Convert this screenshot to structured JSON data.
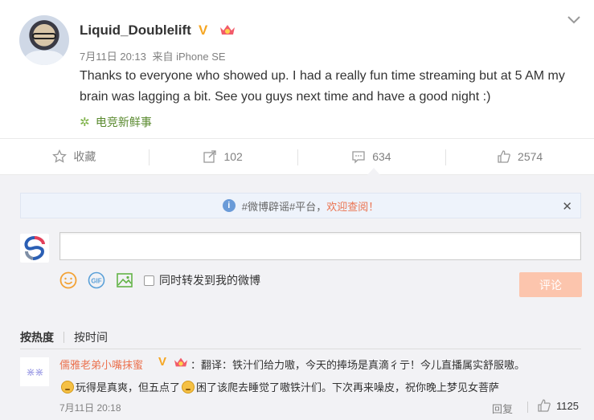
{
  "post": {
    "username": "Liquid_Doublelift",
    "verified_badge": "V",
    "date": "7月11日 20:13",
    "source": "来自 iPhone SE",
    "text": "Thanks to everyone who showed up. I had a really fun time streaming but at 5 AM my brain was lagging a bit. See you guys next time and have a good night :)",
    "topic": "电竞新鲜事"
  },
  "actions": {
    "favorite": "收藏",
    "forward_count": "102",
    "comment_count": "634",
    "like_count": "2574"
  },
  "notice": {
    "prefix": "#微博辟谣#平台，",
    "link": "欢迎查阅！"
  },
  "composer": {
    "input_value": "",
    "forward_label": "同时转发到我的微博",
    "submit_label": "评论"
  },
  "sort": {
    "hot": "按热度",
    "time": "按时间"
  },
  "comment": {
    "avatar_text": "⋇⋇",
    "name": "儒雅老弟小嘴抹蜜",
    "verified_badge": "V",
    "text1": "：翻译：铁汁们给力嗷，今天的捧场是真滴彳亍！今儿直播属实舒服嗷。",
    "text2a": "玩得是真爽，但五点了",
    "text2b": "困了该爬去睡觉了嗷铁汁们。下次再来噪皮，祝你晚上梦见女菩萨",
    "time": "7月11日 20:18",
    "reply": "回复",
    "likes": "1125"
  },
  "colors": {
    "accent_orange": "#eb7350",
    "badge_gold": "#f5a623",
    "topic_green": "#5a8a2f",
    "submit_disabled": "#fcc5ad",
    "panel_bg": "#f2f2f5"
  },
  "icons": [
    "chevron-down-icon",
    "crown-icon",
    "flower-icon",
    "star-icon",
    "forward-icon",
    "comment-icon",
    "like-icon",
    "info-icon",
    "close-icon",
    "weibo-logo-icon",
    "smiley-icon",
    "gif-icon",
    "image-icon",
    "emoji-face-icon"
  ]
}
